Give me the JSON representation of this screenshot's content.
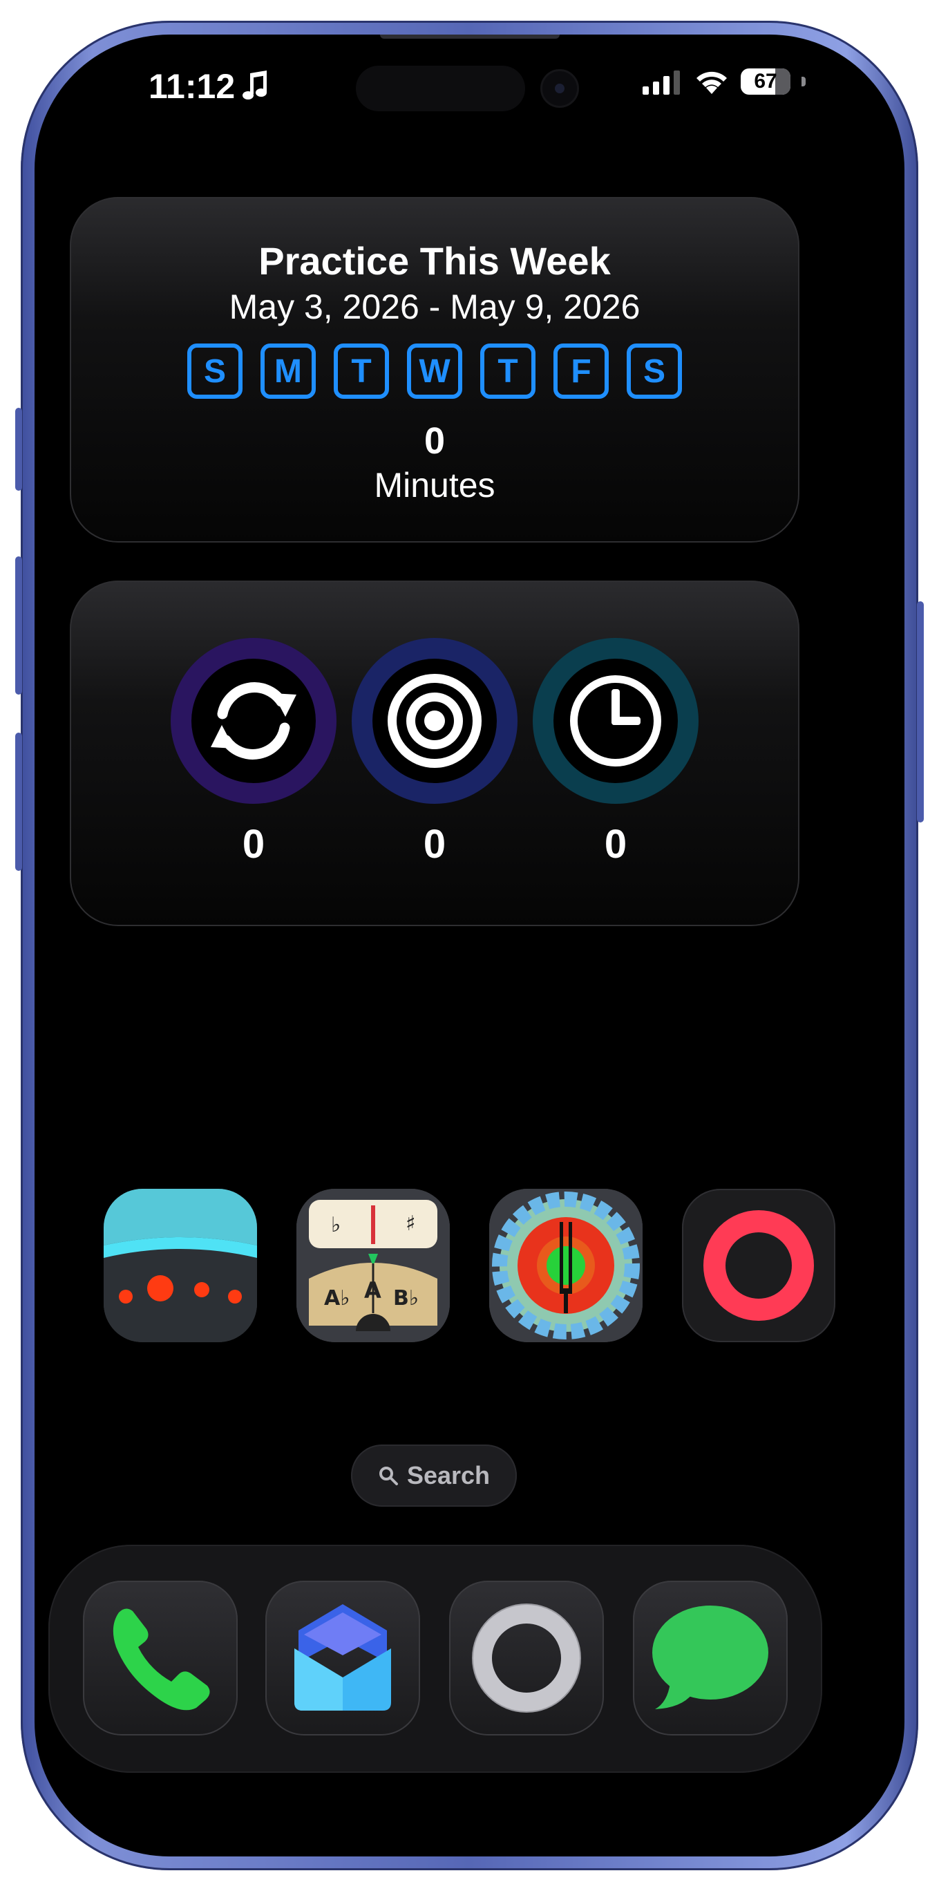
{
  "status_bar": {
    "time": "11:12",
    "battery_level": "67"
  },
  "practice_widget": {
    "title": "Practice This Week",
    "date_range": "May 3, 2026 - May 9, 2026",
    "days": [
      "S",
      "M",
      "T",
      "W",
      "T",
      "F",
      "S"
    ],
    "total_value": "0",
    "total_unit": "Minutes"
  },
  "stats_widget": {
    "items": [
      {
        "icon": "repeat-icon",
        "value": "0",
        "color": "#2a1560"
      },
      {
        "icon": "target-icon",
        "value": "0",
        "color": "#1a2466"
      },
      {
        "icon": "clock-icon",
        "value": "0",
        "color": "#0a3e4e"
      }
    ]
  },
  "home_apps": [
    {
      "icon": "metronome-app-icon"
    },
    {
      "icon": "tuner-meter-app-icon"
    },
    {
      "icon": "tuning-fork-app-icon"
    },
    {
      "icon": "red-ring-app-icon"
    }
  ],
  "search": {
    "label": "Search"
  },
  "dock": [
    {
      "icon": "phone-app-icon"
    },
    {
      "icon": "mail-app-icon"
    },
    {
      "icon": "ring-app-icon"
    },
    {
      "icon": "messages-app-icon"
    }
  ],
  "colors": {
    "accent_blue": "#1f8fff",
    "frame": "#5667b6"
  }
}
